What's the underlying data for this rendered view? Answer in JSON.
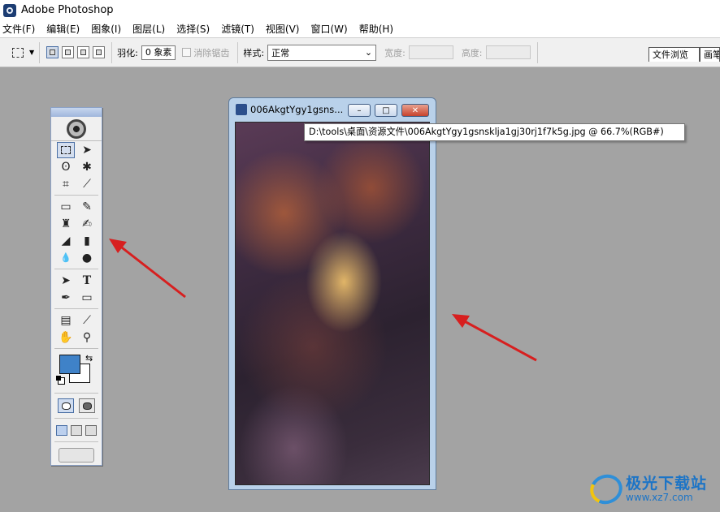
{
  "app": {
    "title": "Adobe Photoshop"
  },
  "menubar": {
    "items": [
      "文件(F)",
      "编辑(E)",
      "图象(I)",
      "图层(L)",
      "选择(S)",
      "滤镜(T)",
      "视图(V)",
      "窗口(W)",
      "帮助(H)"
    ]
  },
  "options": {
    "feather_label": "羽化:",
    "feather_value": "0 象素",
    "antialias_label": "消除锯齿",
    "style_label": "样式:",
    "style_value": "正常",
    "width_label": "宽度:",
    "height_label": "高度:"
  },
  "palette_tabs": [
    "文件浏览",
    "画笔"
  ],
  "toolbox": {
    "tools": [
      [
        "marquee-tool",
        "move-tool"
      ],
      [
        "lasso-tool",
        "magic-wand-tool"
      ],
      [
        "crop-tool",
        "slice-tool"
      ],
      [
        "healing-brush-tool",
        "brush-tool"
      ],
      [
        "clone-stamp-tool",
        "history-brush-tool"
      ],
      [
        "eraser-tool",
        "gradient-tool"
      ],
      [
        "blur-tool",
        "dodge-tool"
      ],
      [
        "path-selection-tool",
        "type-tool"
      ],
      [
        "pen-tool",
        "shape-tool"
      ],
      [
        "notes-tool",
        "eyedropper-tool"
      ],
      [
        "hand-tool",
        "zoom-tool"
      ]
    ],
    "glyphs": {
      "move-tool": "➤",
      "lasso-tool": "ʘ",
      "magic-wand-tool": "✱",
      "crop-tool": "⌗",
      "slice-tool": "⟋",
      "healing-brush-tool": "▭",
      "brush-tool": "✎",
      "clone-stamp-tool": "♜",
      "history-brush-tool": "✍",
      "eraser-tool": "◢",
      "gradient-tool": "▮",
      "blur-tool": "💧",
      "dodge-tool": "●",
      "path-selection-tool": "➤",
      "type-tool": "T",
      "pen-tool": "✒",
      "shape-tool": "▭",
      "notes-tool": "▤",
      "eyedropper-tool": "⟋",
      "hand-tool": "✋",
      "zoom-tool": "⚲"
    },
    "foreground_color": "#3f82c8",
    "background_color": "#ffffff"
  },
  "document": {
    "title": "006AkgtYgy1gsns...",
    "tooltip": "D:\\tools\\桌面\\资源文件\\006AkgtYgy1gsnsklja1gj30rj1f7k5g.jpg @ 66.7%(RGB#)",
    "minimize": "–",
    "maximize": "□",
    "close": "✕"
  },
  "watermark": {
    "title": "极光下载站",
    "url": "www.xz7.com"
  }
}
